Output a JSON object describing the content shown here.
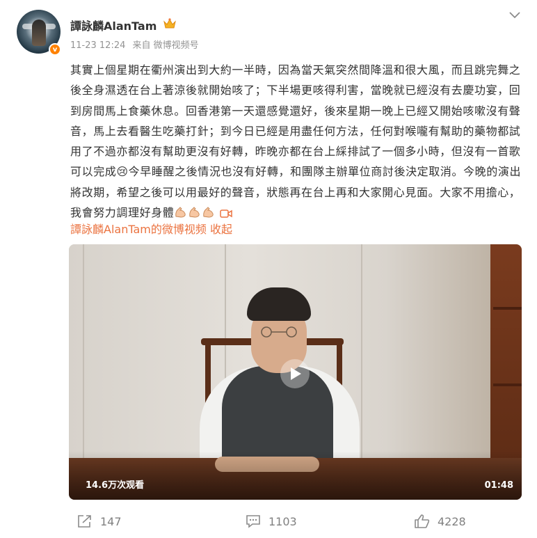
{
  "header": {
    "username": "譚詠麟AlanTam",
    "timestamp": "11-23 12:24",
    "source": "来自 微博视频号",
    "crown_icon": "crown-icon",
    "more_icon": "chevron-down-icon"
  },
  "post": {
    "text": "其實上個星期在衢州演出到大約一半時，因為當天氣突然間降溫和很大風，而且跳完舞之後全身濕透在台上著涼後就開始咳了；下半場更咳得利害，當晚就已經沒有去慶功宴，回到房間馬上食藥休息。回香港第一天還感覺還好，後來星期一晚上已經又開始咳嗽沒有聲音，馬上去看醫生吃藥打針；到今日已經是用盡任何方法，任何對喉嚨有幫助的藥物都試用了不過亦都沒有幫助更沒有好轉，昨晚亦都在台上綵排試了一個多小時，但沒有一首歌可以完成😢今早睡醒之後情況也沒有好轉，和團隊主辦單位商討後決定取消。今晚的演出將改期，希望之後可以用最好的聲音，狀態再在台上再和大家開心見面。大家不用擔心，我會努力調理好身體",
    "emoji_icons": [
      "flexed-biceps-icon",
      "flexed-biceps-icon",
      "flexed-biceps-icon"
    ],
    "video_link_icon": "video-camera-icon",
    "video_link": "譚詠麟AlanTam的微博视频 收起"
  },
  "video": {
    "views": "14.6万次观看",
    "duration": "01:48",
    "play_icon": "play-icon"
  },
  "actions": {
    "share_count": "147",
    "comment_count": "1103",
    "like_count": "4228"
  },
  "colors": {
    "accent": "#eb7340",
    "verified": "#ff8200",
    "muted": "#939393"
  }
}
